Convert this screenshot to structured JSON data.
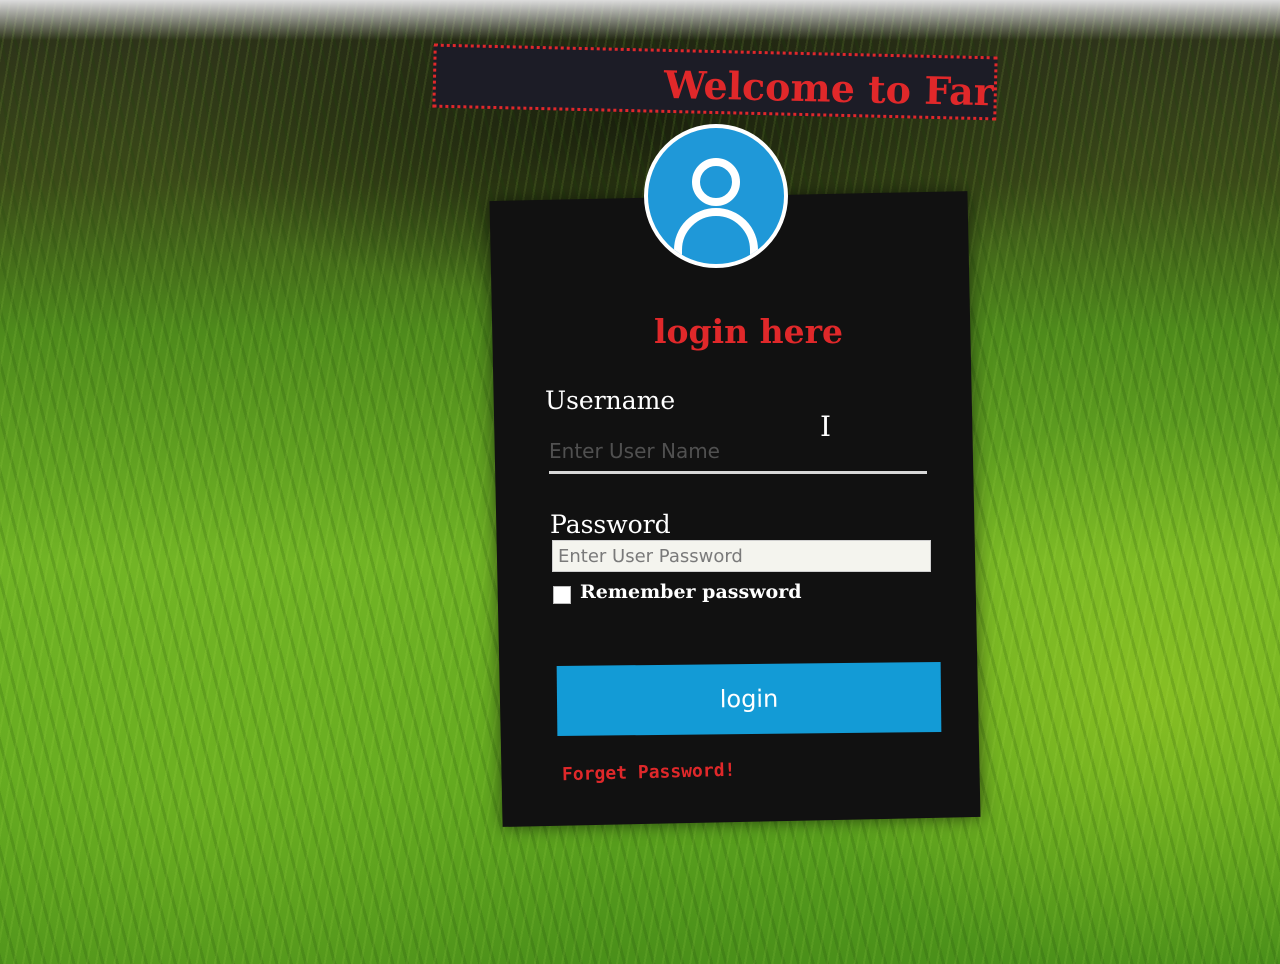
{
  "banner": {
    "text": "Welcome to Faree"
  },
  "login_form": {
    "title": "login here",
    "username_label": "Username",
    "username_placeholder": "Enter User Name",
    "password_label": "Password",
    "password_placeholder": "Enter User Password",
    "remember_label": "Remember password",
    "remember_checked": false,
    "login_button": "login",
    "forget_link": "Forget Password!"
  },
  "icons": {
    "avatar": "user-avatar-icon",
    "cursor": "text-cursor-icon"
  },
  "colors": {
    "accent_red": "#e0282a",
    "button_blue": "#139bd6",
    "avatar_blue": "#1f98d8",
    "panel_bg": "#111111"
  }
}
